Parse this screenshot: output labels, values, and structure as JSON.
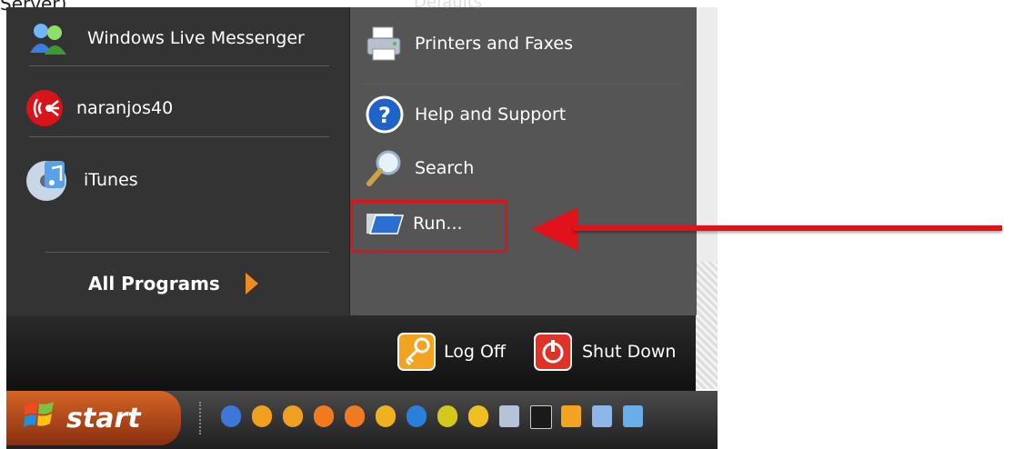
{
  "top_cut_text": "Server)",
  "left_items": [
    {
      "label": "Windows Live Messenger",
      "icon": "windows-live-messenger-icon"
    },
    {
      "label": "naranjos40",
      "icon": "naranjos40-icon"
    },
    {
      "label": "iTunes",
      "icon": "itunes-icon"
    }
  ],
  "all_programs_label": "All Programs",
  "right_items": [
    {
      "label": "Printers and Faxes",
      "icon": "printer-icon"
    },
    {
      "label": "Help and Support",
      "icon": "help-icon"
    },
    {
      "label": "Search",
      "icon": "search-icon"
    },
    {
      "label": "Run...",
      "icon": "run-icon"
    }
  ],
  "partial_label": "Defaults",
  "bottom": {
    "log_off": "Log Off",
    "shut_down": "Shut Down"
  },
  "taskbar": {
    "start_label": "start"
  },
  "colors": {
    "accent_red": "#e1131a",
    "menu_dark": "#333333",
    "menu_right": "#555555",
    "start_orange": "#d46426"
  }
}
